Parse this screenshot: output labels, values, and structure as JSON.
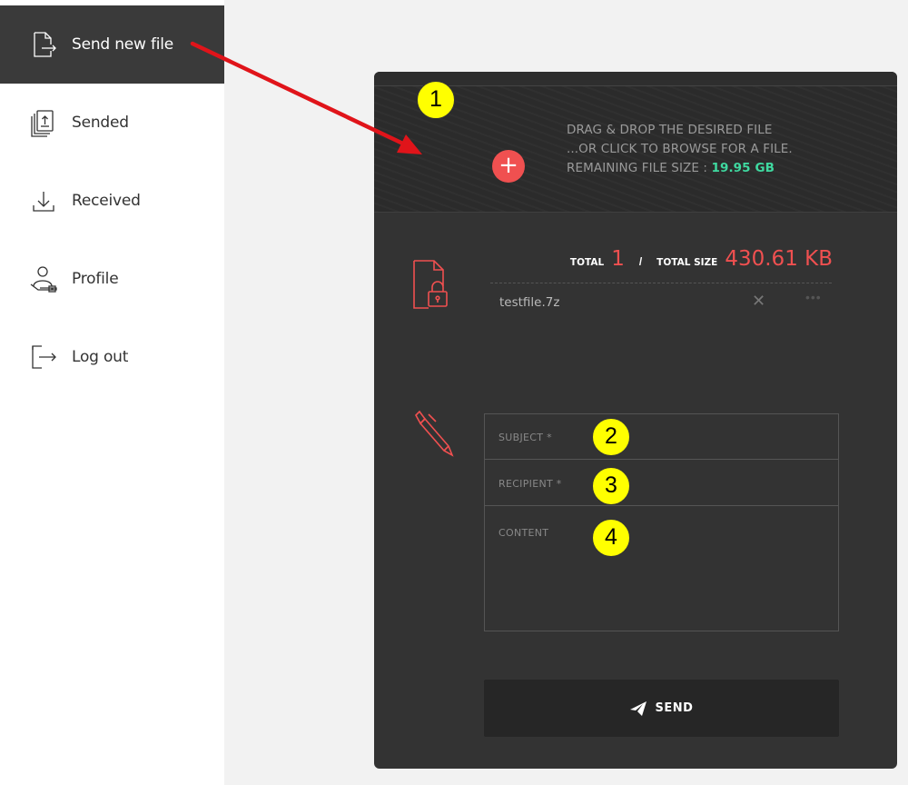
{
  "sidebar": {
    "items": [
      {
        "label": "Send new file",
        "icon": "send-file-icon",
        "active": true
      },
      {
        "label": "Sended",
        "icon": "sended-files-icon",
        "active": false
      },
      {
        "label": "Received",
        "icon": "download-icon",
        "active": false
      },
      {
        "label": "Profile",
        "icon": "profile-icon",
        "active": false
      },
      {
        "label": "Log out",
        "icon": "logout-icon",
        "active": false
      }
    ]
  },
  "upload": {
    "line1": "DRAG & DROP THE DESIRED FILE",
    "line2": "...OR CLICK TO BROWSE FOR A FILE.",
    "remaining_label": "REMAINING FILE SIZE : ",
    "remaining_value": "19.95 GB",
    "add_symbol": "+"
  },
  "files": {
    "total_label": "TOTAL",
    "total_count": "1",
    "separator": "/",
    "total_size_label": "TOTAL SIZE",
    "total_size": "430.61 KB",
    "items": [
      {
        "name": "testfile.7z",
        "remove_symbol": "✕",
        "more_symbol": "•••"
      }
    ]
  },
  "form": {
    "subject_placeholder": "SUBJECT *",
    "recipient_placeholder": "RECIPIENT *",
    "content_placeholder": "CONTENT"
  },
  "send": {
    "label": "SEND",
    "icon": "paper-plane-icon"
  },
  "annotations": {
    "markers": [
      "1",
      "2",
      "3",
      "4"
    ],
    "marker_color": "#ffff00",
    "arrow_color": "#e0141a"
  },
  "colors": {
    "accent": "#f05050",
    "size_highlight": "#3fd9a0",
    "card_bg": "#333333",
    "active_nav_bg": "#3a3a3a"
  }
}
